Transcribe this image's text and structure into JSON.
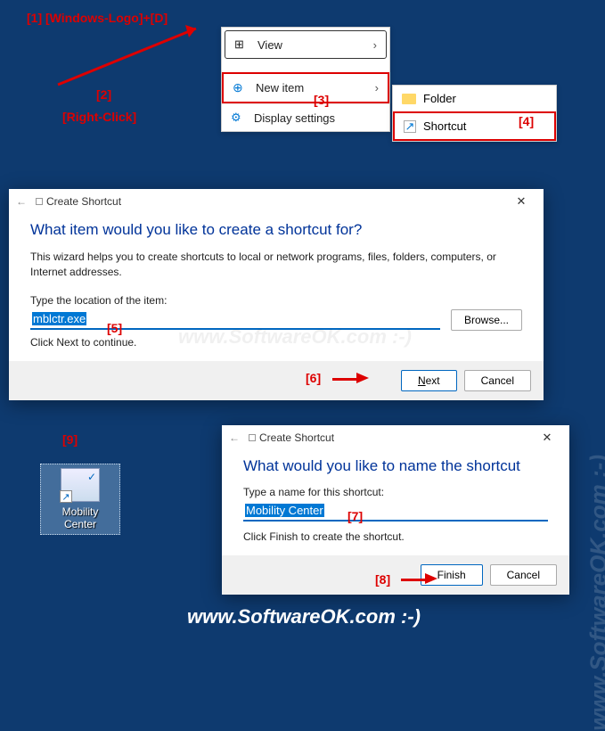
{
  "annotations": {
    "a1": "[1]  [Windows-Logo]+[D]",
    "a2": "[2]",
    "rightClick": "[Right-Click]",
    "a3": "[3]",
    "a4": "[4]",
    "a5": "[5]",
    "a6": "[6]",
    "a7": "[7]",
    "a8": "[8]",
    "a9": "[9]"
  },
  "contextMenu": {
    "view": "View",
    "newItem": "New item",
    "displaySettings": "Display settings"
  },
  "submenu": {
    "folder": "Folder",
    "shortcut": "Shortcut"
  },
  "dialog1": {
    "title": "Create Shortcut",
    "heading": "What item would you like to create a shortcut for?",
    "description": "This wizard helps you to create shortcuts to local or network programs, files, folders, computers, or Internet addresses.",
    "fieldLabel": "Type the location of the item:",
    "inputValue": "mblctr.exe",
    "browse": "Browse...",
    "hint": "Click Next to continue.",
    "next": "Next",
    "cancel": "Cancel"
  },
  "dialog2": {
    "title": "Create Shortcut",
    "heading": "What would you like to name the shortcut",
    "fieldLabel": "Type a name for this shortcut:",
    "inputValue": "Mobility Center",
    "hint": "Click Finish to create the shortcut.",
    "finish": "Finish",
    "cancel": "Cancel"
  },
  "desktopIcon": {
    "label": "Mobility Center"
  },
  "watermark": "www.SoftwareOK.com :-)"
}
